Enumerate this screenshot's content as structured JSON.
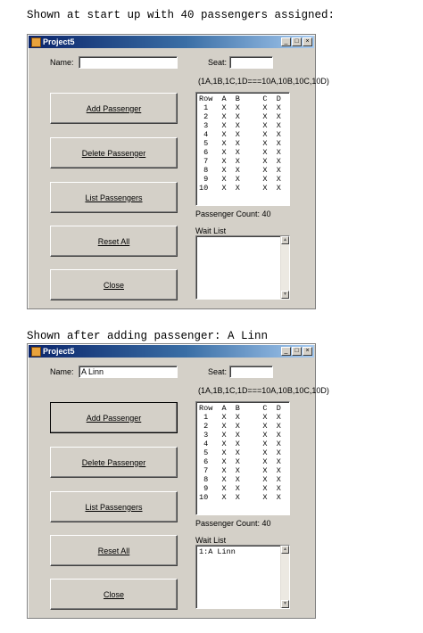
{
  "captions": {
    "first": "Shown at start up with 40 passengers assigned:",
    "second": "Shown after adding passenger: A Linn"
  },
  "windows": [
    {
      "title": "Project5",
      "title_buttons": [
        "_",
        "□",
        "×"
      ],
      "name_label": "Name:",
      "name_value": "",
      "seat_label": "Seat:",
      "seat_value": "",
      "seat_hint": "(1A,1B,1C,1D===10A,10B,10C,10D)",
      "seat_table": "Row  A  B     C  D\n 1   X  X     X  X\n 2   X  X     X  X\n 3   X  X     X  X\n 4   X  X     X  X\n 5   X  X     X  X\n 6   X  X     X  X\n 7   X  X     X  X\n 8   X  X     X  X\n 9   X  X     X  X\n10   X  X     X  X",
      "passenger_count": "Passenger Count: 40",
      "wait_list_label": "Wait List",
      "wait_list_text": "",
      "buttons": [
        "Add Passenger",
        "Delete Passenger",
        "List Passengers",
        "Reset All",
        "Close"
      ]
    },
    {
      "title": "Project5",
      "title_buttons": [
        "_",
        "□",
        "×"
      ],
      "name_label": "Name:",
      "name_value": "A Linn",
      "seat_label": "Seat:",
      "seat_value": "",
      "seat_hint": "(1A,1B,1C,1D===10A,10B,10C,10D)",
      "seat_table": "Row  A  B     C  D\n 1   X  X     X  X\n 2   X  X     X  X\n 3   X  X     X  X\n 4   X  X     X  X\n 5   X  X     X  X\n 6   X  X     X  X\n 7   X  X     X  X\n 8   X  X     X  X\n 9   X  X     X  X\n10   X  X     X  X",
      "passenger_count": "Passenger Count: 40",
      "wait_list_label": "Wait List",
      "wait_list_text": "1:A Linn",
      "buttons": [
        "Add Passenger",
        "Delete Passenger",
        "List Passengers",
        "Reset All",
        "Close"
      ]
    }
  ],
  "colors": {
    "form_background": "#d4d0c8",
    "titlebar_start": "#0a246a",
    "titlebar_end": "#a6caf0"
  }
}
